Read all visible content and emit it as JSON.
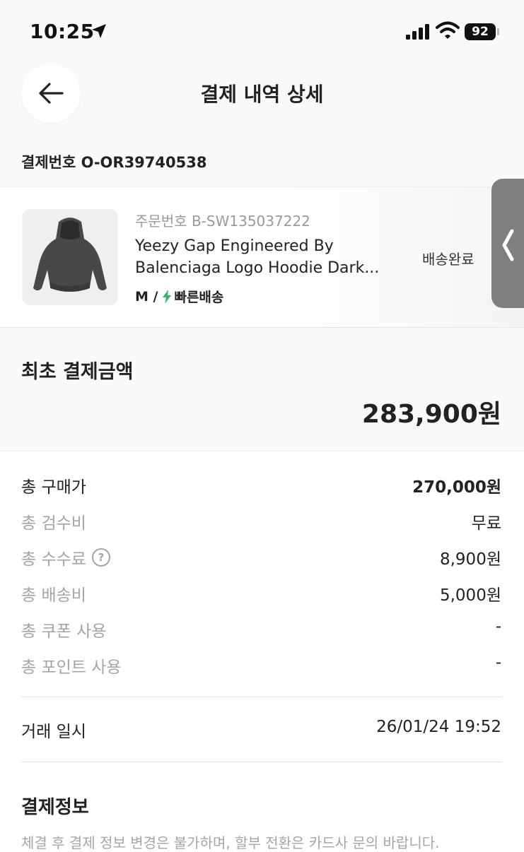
{
  "status_bar": {
    "time": "10:25",
    "battery": "92"
  },
  "header": {
    "title": "결제 내역 상세"
  },
  "payment": {
    "number_label": "결제번호 O-OR39740538"
  },
  "product": {
    "order_no": "주문번호 B-SW135037222",
    "name_line1": "Yeezy Gap Engineered By",
    "name_line2": "Balenciaga Logo Hoodie Dark...",
    "size": "M /",
    "shipping": "빠른배송",
    "status": "배송완료"
  },
  "initial": {
    "label": "최초 결제금액",
    "amount": "283,900원"
  },
  "breakdown": [
    {
      "label": "총 구매가",
      "value": "270,000원"
    },
    {
      "label": "총 검수비",
      "value": "무료"
    },
    {
      "label": "총 수수료",
      "value": "8,900원"
    },
    {
      "label": "총 배송비",
      "value": "5,000원"
    },
    {
      "label": "총 쿠폰 사용",
      "value": "-"
    },
    {
      "label": "총 포인트 사용",
      "value": "-"
    }
  ],
  "help_icon": "?",
  "trade": {
    "label": "거래 일시",
    "value": "26/01/24 19:52"
  },
  "payinfo": {
    "title": "결제정보",
    "notice": "체결 후 결제 정보 변경은 불가하며, 할부 전환은 카드사 문의 바랍니다."
  },
  "colors": {
    "accent_green": "#31b46c",
    "muted": "#a5a5a5",
    "text": "#222222"
  },
  "icons": [
    "location-arrow-icon",
    "signal-icon",
    "wifi-icon",
    "battery-icon",
    "back-arrow-icon",
    "lightning-icon",
    "help-circle-icon",
    "chevron-left-icon"
  ]
}
